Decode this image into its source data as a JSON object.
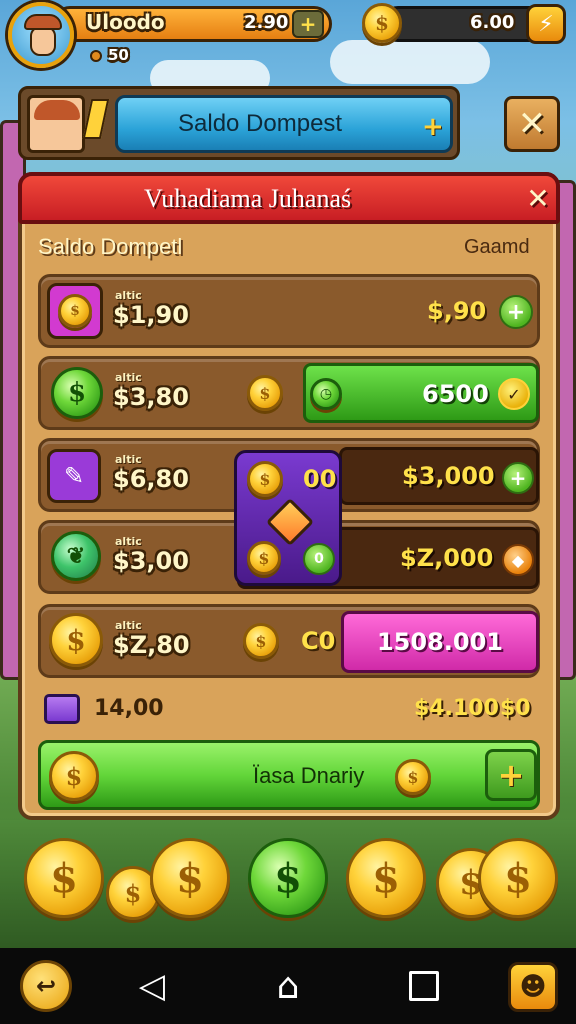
{
  "top_bar": {
    "player_name": "Uloodo",
    "player_sub": "50",
    "gold_amount": "2.90",
    "coin_amount": "6.00"
  },
  "banner": {
    "title": "Saldo Dompest"
  },
  "panel": {
    "title": "Vuhadiama Juhanaś",
    "section_left": "Saldo Dompetl",
    "section_right": "Gaamd",
    "rows": [
      {
        "tag": "altic",
        "price": "$1,90",
        "value": "$,90"
      },
      {
        "tag": "altic",
        "price": "$3,80",
        "value": "6500"
      },
      {
        "tag": "altic",
        "price": "$6,80",
        "value": "$3,000",
        "popup_value": "00"
      },
      {
        "tag": "altic",
        "price": "$3,00",
        "value": "$Z,000"
      },
      {
        "tag": "altic",
        "price": "$Z,80",
        "mid_value": "C0",
        "value": "1508.001"
      }
    ],
    "summary_left": "14,00",
    "summary_right": "$4.100",
    "summary_right_extra": "$0",
    "action_label": "Ïasa Dnariy"
  },
  "colors": {
    "panel_bg": "#d9a35a",
    "header_red": "#d8242a",
    "banner_blue": "#2ba3d8",
    "action_green": "#63d63a",
    "pink": "#e23fb8"
  }
}
